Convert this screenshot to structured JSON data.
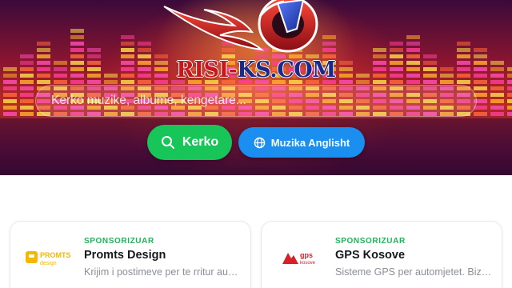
{
  "hero": {
    "logo_main": "RISI-",
    "logo_domain": "KS.COM"
  },
  "search": {
    "placeholder": "Kerko muzike, albume, kengetare..."
  },
  "buttons": {
    "search_label": "Kerko",
    "english_label": "Muzika Anglisht"
  },
  "sponsored": [
    {
      "tag": "SPONSORIZUAR",
      "name": "Promts Design",
      "description": "Krijim i postimeve per te rritur audiencen",
      "logo_line1": "PROMTS",
      "logo_line2": "design",
      "logo_color": "#f5b800"
    },
    {
      "tag": "SPONSORIZUAR",
      "name": "GPS Kosove",
      "description": "Sisteme GPS per automjetet. Bizneset",
      "logo_line1": "gps",
      "logo_line2": "kosove",
      "logo_color": "#d8202a"
    }
  ],
  "colors": {
    "accent_green": "#18c558",
    "accent_blue": "#1a8ff0",
    "sponsor_tag": "#21b35a"
  }
}
